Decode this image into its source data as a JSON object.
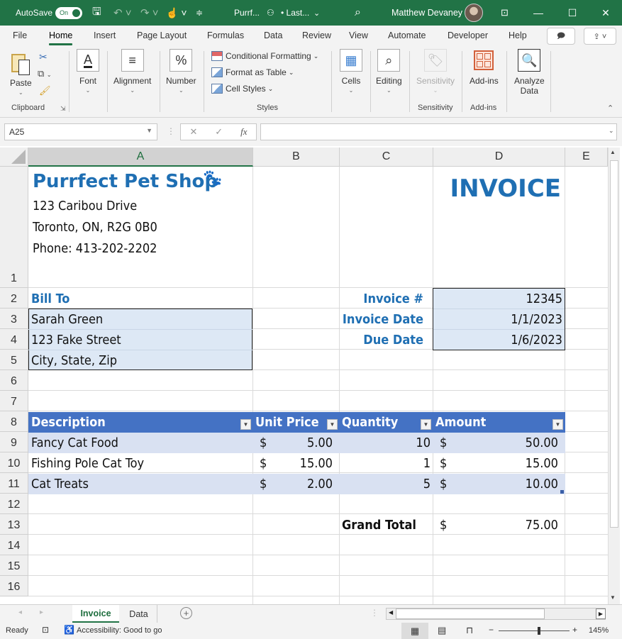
{
  "titlebar": {
    "autosave_label": "AutoSave",
    "autosave_state": "On",
    "file_name": "Purrf...",
    "save_status": "• Last...",
    "user_name": "Matthew Devaney"
  },
  "menu": {
    "tabs": [
      "File",
      "Home",
      "Insert",
      "Page Layout",
      "Formulas",
      "Data",
      "Review",
      "View",
      "Automate",
      "Developer",
      "Help"
    ],
    "active": "Home"
  },
  "ribbon": {
    "paste": "Paste",
    "clipboard": "Clipboard",
    "font": "Font",
    "alignment": "Alignment",
    "number": "Number",
    "conditional_formatting": "Conditional Formatting",
    "format_as_table": "Format as Table",
    "cell_styles": "Cell Styles",
    "styles": "Styles",
    "cells": "Cells",
    "editing": "Editing",
    "sensitivity_btn": "Sensitivity",
    "sensitivity_group": "Sensitivity",
    "addins_btn": "Add-ins",
    "addins_group": "Add-ins",
    "analyze_data_1": "Analyze",
    "analyze_data_2": "Data"
  },
  "formula_bar": {
    "name_box": "A25",
    "fx": "fx",
    "formula": ""
  },
  "columns": [
    "A",
    "B",
    "C",
    "D",
    "E"
  ],
  "rows": [
    "1",
    "2",
    "3",
    "4",
    "5",
    "6",
    "7",
    "8",
    "9",
    "10",
    "11",
    "12",
    "13",
    "14",
    "15",
    "16"
  ],
  "sheet": {
    "company": "Purrfect Pet Shop",
    "address1": "123 Caribou Drive",
    "address2": "Toronto, ON, R2G 0B0",
    "phone": "Phone: 413-202-2202",
    "title": "INVOICE",
    "bill_to_label": "Bill To",
    "bill_to": [
      "Sarah Green",
      "123 Fake Street",
      "City, State, Zip"
    ],
    "invoice_no_label": "Invoice #",
    "invoice_no": "12345",
    "invoice_date_label": "Invoice Date",
    "invoice_date": "1/1/2023",
    "due_date_label": "Due Date",
    "due_date": "1/6/2023",
    "table_headers": [
      "Description",
      "Unit Price",
      "Quantity",
      "Amount"
    ],
    "items": [
      {
        "description": "Fancy Cat Food",
        "unit_price": "5.00",
        "quantity": "10",
        "amount": "50.00"
      },
      {
        "description": "Fishing Pole Cat Toy",
        "unit_price": "15.00",
        "quantity": "1",
        "amount": "15.00"
      },
      {
        "description": "Cat Treats",
        "unit_price": "2.00",
        "quantity": "5",
        "amount": "10.00"
      }
    ],
    "currency": "$",
    "grand_total_label": "Grand Total",
    "grand_total": "75.00"
  },
  "sheet_tabs": [
    "Invoice",
    "Data"
  ],
  "active_sheet": "Invoice",
  "status": {
    "ready": "Ready",
    "accessibility": "Accessibility: Good to go",
    "zoom": "145%"
  }
}
